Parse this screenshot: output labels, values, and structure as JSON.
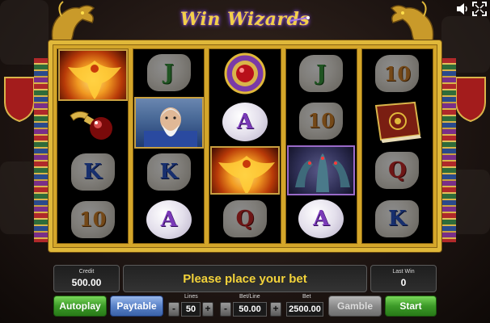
{
  "game": {
    "logo_text": "Win Wizards"
  },
  "top_bar": {
    "sound_icon": "speaker-icon",
    "fullscreen_icon": "fullscreen-icon"
  },
  "reels": [
    [
      "phoenix",
      "potion",
      "K",
      "10"
    ],
    [
      "J",
      "wizard",
      "K",
      "A"
    ],
    [
      "amulet",
      "A",
      "phoenix",
      "Q"
    ],
    [
      "J",
      "10",
      "dragons",
      "A"
    ],
    [
      "10",
      "spellbook",
      "Q",
      "K"
    ]
  ],
  "panel": {
    "credit_label": "Credit",
    "credit_value": "500.00",
    "message": "Please place your bet",
    "last_win_label": "Last Win",
    "last_win_value": "0",
    "autoplay_label": "Autoplay",
    "paytable_label": "Paytable",
    "lines_label": "Lines",
    "lines_value": "50",
    "bet_line_label": "Bet/Line",
    "bet_line_value": "50.00",
    "bet_label": "Bet",
    "bet_value": "2500.00",
    "gamble_label": "Gamble",
    "start_label": "Start",
    "minus_label": "-",
    "plus_label": "+"
  },
  "colors": {
    "frame_gold": "#e0b83a",
    "message_yellow": "#f2d23a",
    "button_green": "#3c9a28",
    "button_blue": "#5a82c8",
    "button_grey": "#8a8a8a"
  }
}
